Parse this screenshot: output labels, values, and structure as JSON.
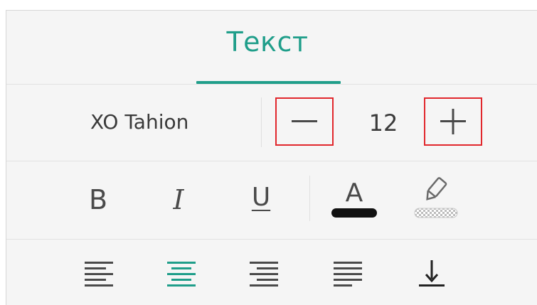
{
  "tab": {
    "label": "Текст"
  },
  "font": {
    "name": "XO Tahion",
    "size": "12"
  },
  "icons": {
    "decrease": "minus-icon",
    "increase": "plus-icon",
    "bold": "B",
    "italic": "I",
    "underline": "U",
    "text_color": "A",
    "highlight": "highlighter-icon",
    "align_left": "align-left-icon",
    "align_center": "align-center-icon",
    "align_right": "align-right-icon",
    "align_justify": "align-justify-icon",
    "align_bottom": "align-bottom-icon"
  },
  "colors": {
    "accent": "#1f9e8a",
    "highlight_box": "#e1272c",
    "text_color_swatch": "#111111"
  },
  "state": {
    "active_alignment": "center"
  }
}
